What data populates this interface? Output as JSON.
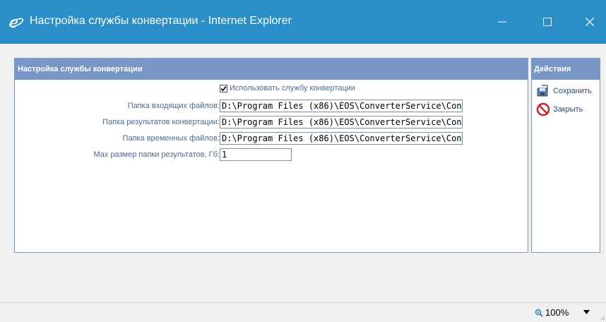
{
  "window": {
    "title": "Настройка службы конвертации - Internet Explorer"
  },
  "main_panel": {
    "header": "Настройка службы конвертации",
    "checkbox_label": "Использовать службу конвертации",
    "checkbox_checked": true,
    "fields": [
      {
        "label": "Папка входящих файлов:",
        "value": "D:\\Program Files (x86)\\EOS\\ConverterService\\Con"
      },
      {
        "label": "Папка результатов конвертации:",
        "value": "D:\\Program Files (x86)\\EOS\\ConverterService\\Con"
      },
      {
        "label": "Папка временных файлов:",
        "value": "D:\\Program Files (x86)\\EOS\\ConverterService\\Con"
      },
      {
        "label": "Max размер папки результатов, Гб:",
        "value": "1"
      }
    ]
  },
  "side_panel": {
    "header": "Действия",
    "actions": [
      {
        "label": "Сохранить",
        "icon": "save-icon"
      },
      {
        "label": "Закрыть",
        "icon": "close-circle-icon"
      }
    ]
  },
  "statusbar": {
    "zoom_label": "100%",
    "zoom_icon": "zoom-icon"
  },
  "colors": {
    "titlebar": "#2a8fc8",
    "panel_header": "#7997c6",
    "label_text": "#4a6b9a"
  }
}
